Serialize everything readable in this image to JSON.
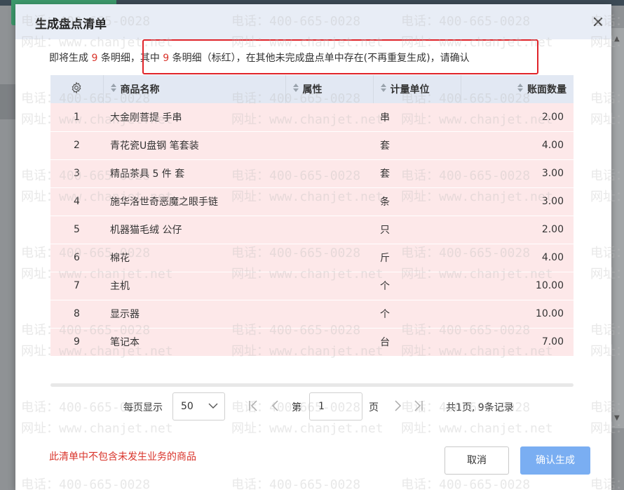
{
  "dialog": {
    "title": "生成盘点清单",
    "message": {
      "part1": "即将生成 ",
      "total_count": "9",
      "part2": " 条明细，其中 ",
      "red_count": "9",
      "part3": " 条明细（标红），在其他未完成盘点单中存在(不再重复生成)，请确认"
    }
  },
  "table": {
    "headers": {
      "name": "商品名称",
      "attribute": "属性",
      "unit": "计量单位",
      "quantity": "账面数量"
    },
    "rows": [
      {
        "index": "1",
        "name": "大金刚菩提 手串",
        "attribute": "",
        "unit": "串",
        "quantity": "2.00"
      },
      {
        "index": "2",
        "name": "青花瓷U盘钢 笔套装",
        "attribute": "",
        "unit": "套",
        "quantity": "4.00"
      },
      {
        "index": "3",
        "name": "精品茶具 5 件 套",
        "attribute": "",
        "unit": "套",
        "quantity": "3.00"
      },
      {
        "index": "4",
        "name": "施华洛世奇恶魔之眼手链",
        "attribute": "",
        "unit": "条",
        "quantity": "3.00"
      },
      {
        "index": "5",
        "name": "机器猫毛绒 公仔",
        "attribute": "",
        "unit": "只",
        "quantity": "2.00"
      },
      {
        "index": "6",
        "name": "棉花",
        "attribute": "",
        "unit": "斤",
        "quantity": "4.00"
      },
      {
        "index": "7",
        "name": "主机",
        "attribute": "",
        "unit": "个",
        "quantity": "10.00"
      },
      {
        "index": "8",
        "name": "显示器",
        "attribute": "",
        "unit": "个",
        "quantity": "10.00"
      },
      {
        "index": "9",
        "name": "笔记本",
        "attribute": "",
        "unit": "台",
        "quantity": "7.00"
      }
    ]
  },
  "pagination": {
    "per_page_label": "每页显示",
    "page_size": "50",
    "page_prefix": "第",
    "current_page": "1",
    "page_suffix": "页",
    "summary": "共1页, 9条记录"
  },
  "footer": {
    "note": "此清单中不包含未发生业务的商品",
    "cancel_label": "取消",
    "confirm_label": "确认生成"
  },
  "watermark": {
    "phone": "电话：400-665-0028",
    "site": "网址：www.chanjet.net"
  },
  "colors": {
    "highlight_row": "#fde8e9",
    "header_bg": "#e8edf6",
    "accent_red": "#d9342b",
    "confirm_button": "#7aaef2",
    "annotation_box": "#e0242a"
  }
}
